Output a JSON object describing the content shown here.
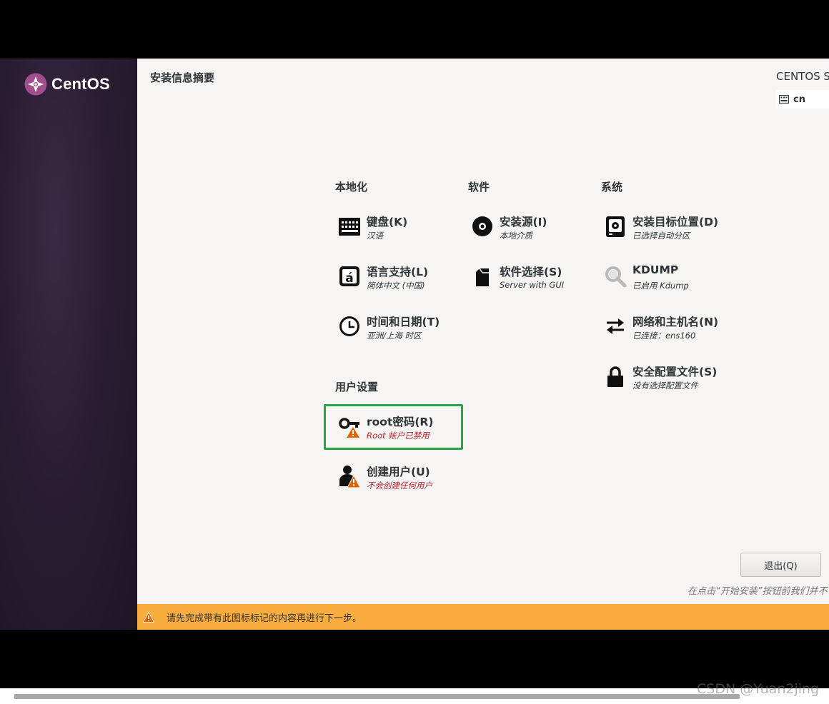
{
  "brand": {
    "name": "CentOS"
  },
  "header": {
    "title": "安装信息摘要",
    "product": "CENTOS S",
    "keyboard_layout": "cn"
  },
  "categories": {
    "localization": "本地化",
    "software": "软件",
    "system": "系统",
    "user_settings": "用户设置"
  },
  "spokes": {
    "keyboard": {
      "label": "键盘(K)",
      "status": "汉语",
      "icon": "keyboard-icon"
    },
    "language": {
      "label": "语言支持(L)",
      "status": "简体中文 (中国)",
      "icon": "language-icon"
    },
    "datetime": {
      "label": "时间和日期(T)",
      "status": "亚洲/上海 时区",
      "icon": "clock-icon"
    },
    "source": {
      "label": "安装源(I)",
      "status": "本地介质",
      "icon": "disc-icon"
    },
    "software_selection": {
      "label": "软件选择(S)",
      "status": "Server with GUI",
      "icon": "package-icon"
    },
    "destination": {
      "label": "安装目标位置(D)",
      "status": "已选择自动分区",
      "icon": "harddisk-icon"
    },
    "kdump": {
      "label": "KDUMP",
      "status": "已启用 Kdump",
      "icon": "magnifier-icon"
    },
    "network": {
      "label": "网络和主机名(N)",
      "status": "已连接：ens160",
      "icon": "network-arrows-icon"
    },
    "security": {
      "label": "安全配置文件(S)",
      "status": "没有选择配置文件",
      "icon": "lock-icon"
    },
    "root": {
      "label": "root密码(R)",
      "status": "Root 帐户已禁用",
      "icon": "key-warning-icon"
    },
    "user": {
      "label": "创建用户(U)",
      "status": "不会创建任何用户",
      "icon": "user-warning-icon"
    }
  },
  "footer": {
    "quit_label": "退出(Q)",
    "hint": "在点击“开始安装”按钮前我们并不"
  },
  "warning_bar": {
    "text": "请先完成带有此图标标记的内容再进行下一步。"
  },
  "watermark": "CSDN @Yuan2jing",
  "colors": {
    "warning_bar": "#f9ad3f",
    "highlight": "#26a641",
    "status_warn": "#c01c28",
    "sidebar": "#2a1d33"
  }
}
